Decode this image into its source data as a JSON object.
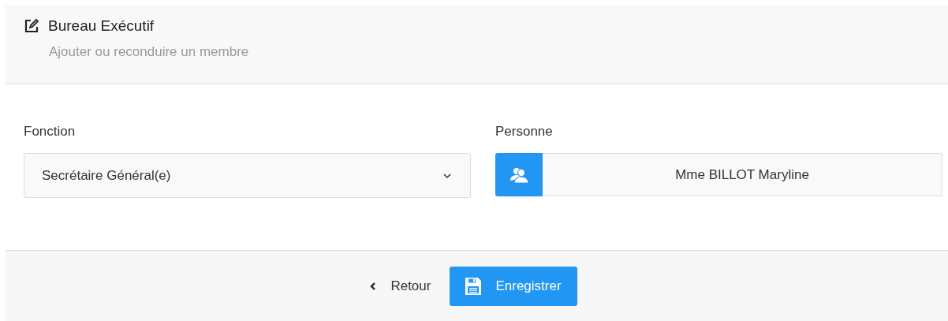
{
  "header": {
    "title": "Bureau Exécutif",
    "subtitle": "Ajouter ou reconduire un membre"
  },
  "fields": [
    {
      "kind": "select",
      "label": "Fonction",
      "value": "Secrétaire Général(e)"
    },
    {
      "kind": "person",
      "label": "Personne",
      "value": "Mme BILLOT Maryline"
    }
  ],
  "footer": {
    "back": "Retour",
    "save": "Enregistrer"
  }
}
